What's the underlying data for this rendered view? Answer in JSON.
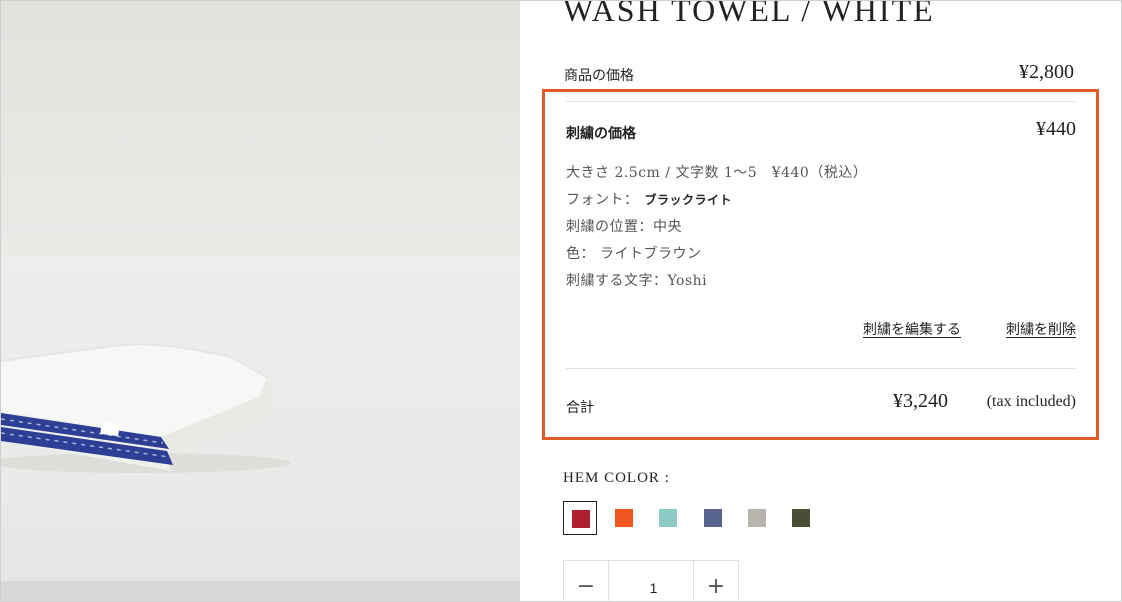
{
  "product": {
    "title": "WASH TOWEL / WHITE",
    "price_label": "商品の価格",
    "price": "¥2,800"
  },
  "embroidery": {
    "label": "刺繍の価格",
    "price": "¥440",
    "details": [
      {
        "text": "大きさ 2.5cm / 文字数 1〜5　¥440（税込）",
        "strong": ""
      },
      {
        "text": "フォント：",
        "strong": "ブラックライト"
      },
      {
        "text": "刺繍の位置：中央",
        "strong": ""
      },
      {
        "text": "色： ライトブラウン",
        "strong": ""
      },
      {
        "text": "刺繍する文字：Yoshi",
        "strong": ""
      }
    ],
    "edit_label": "刺繍を編集する",
    "delete_label": "刺繍を削除"
  },
  "total": {
    "label": "合計",
    "amount": "¥3,240",
    "tax_note": "(tax included)"
  },
  "hem_color": {
    "label": "HEM COLOR :",
    "swatches": [
      {
        "color": "#b01f2e",
        "selected": true
      },
      {
        "color": "#f0561f",
        "selected": false
      },
      {
        "color": "#8ccac5",
        "selected": false
      },
      {
        "color": "#56648f",
        "selected": false
      },
      {
        "color": "#b7b4ad",
        "selected": false
      },
      {
        "color": "#4a4e37",
        "selected": false
      }
    ]
  },
  "quantity": {
    "minus": "−",
    "value": "1",
    "plus": "+"
  },
  "colors": {
    "highlight": "#e2592a",
    "towel_trim": "#2c3f95"
  }
}
